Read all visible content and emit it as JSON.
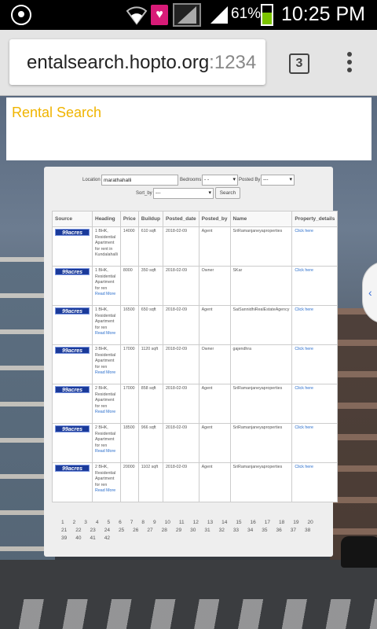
{
  "status_bar": {
    "battery_pct": "61%",
    "battery_level": 0.61,
    "time": "10:25 PM",
    "icons": [
      "whatsapp-icon",
      "wifi-icon",
      "heart-notification-icon",
      "signal-box-icon",
      "signal-icon",
      "battery-icon"
    ]
  },
  "browser": {
    "url_host": "entalsearch.hopto.org",
    "url_port": ":1234",
    "tab_count": "3"
  },
  "page": {
    "title": "Rental Search",
    "form": {
      "location_label": "Location",
      "location_value": "marathahalli",
      "bedrooms_label": "Bedrooms",
      "bedrooms_value": "- -",
      "posted_by_label": "Posted By",
      "posted_by_value": "---",
      "sort_by_label": "Sort_by",
      "sort_by_value": "---",
      "search_button": "Search"
    },
    "table": {
      "headers": [
        "Source",
        "Heading",
        "Price",
        "Buildup",
        "Posted_date",
        "Posted_by",
        "Name",
        "Property_details"
      ],
      "source_logo": "99acres",
      "rows": [
        {
          "heading": "1 BHK, Residential Apartment for rent in Kundalahalli",
          "read_more": "",
          "price": "14000",
          "buildup": "610 sqft",
          "date": "2018-02-09",
          "posted_by": "Agent",
          "name": "SriRamanjaneyaproperties",
          "details": "Click here"
        },
        {
          "heading": "1 BHK, Residential Apartment for ren",
          "read_more": "Read More",
          "price": "8000",
          "buildup": "350 sqft",
          "date": "2018-02-09",
          "posted_by": "Owner",
          "name": "SKar",
          "details": "Click here"
        },
        {
          "heading": "1 BHK, Residential Apartment for ren",
          "read_more": "Read More",
          "price": "16500",
          "buildup": "650 sqft",
          "date": "2018-02-09",
          "posted_by": "Agent",
          "name": "SaiSannidhiRealEstateAgency",
          "details": "Click here"
        },
        {
          "heading": "3 BHK, Residential Apartment for ren",
          "read_more": "Read More",
          "price": "17000",
          "buildup": "1120 sqft",
          "date": "2018-02-09",
          "posted_by": "Owner",
          "name": "gajendhra",
          "details": "Click here"
        },
        {
          "heading": "2 BHK, Residential Apartment for ren",
          "read_more": "Read More",
          "price": "17000",
          "buildup": "858 sqft",
          "date": "2018-02-09",
          "posted_by": "Agent",
          "name": "SriRamanjaneyaproperties",
          "details": "Click here"
        },
        {
          "heading": "2 BHK, Residential Apartment for ren",
          "read_more": "Read More",
          "price": "18500",
          "buildup": "966 sqft",
          "date": "2018-02-09",
          "posted_by": "Agent",
          "name": "SriRamanjaneyaproperties",
          "details": "Click here"
        },
        {
          "heading": "2 BHK, Residential Apartment for ren",
          "read_more": "Read More",
          "price": "20000",
          "buildup": "1102 sqft",
          "date": "2018-02-09",
          "posted_by": "Agent",
          "name": "SriRamanjaneyaproperties",
          "details": "Click here"
        }
      ]
    },
    "pagination": [
      "1",
      "2",
      "3",
      "4",
      "5",
      "6",
      "7",
      "8",
      "9",
      "10",
      "11",
      "12",
      "13",
      "14",
      "15",
      "16",
      "17",
      "18",
      "19",
      "20",
      "21",
      "22",
      "23",
      "24",
      "25",
      "26",
      "27",
      "28",
      "29",
      "30",
      "31",
      "32",
      "33",
      "34",
      "35",
      "36",
      "37",
      "38",
      "39",
      "40",
      "41",
      "42"
    ]
  },
  "colors": {
    "title": "#f0b400",
    "link": "#2a6ecc",
    "battery_fill": "#7cc400"
  }
}
